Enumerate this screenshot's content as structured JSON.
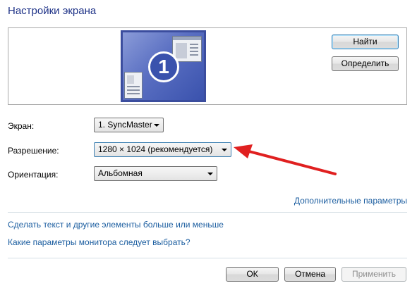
{
  "window": {
    "title": "Настройки экрана"
  },
  "monitor_preview": {
    "monitor_number": "1",
    "identify_buttons": {
      "find": "Найти",
      "detect": "Определить"
    }
  },
  "settings": {
    "display": {
      "label": "Экран:",
      "value": "1. SyncMaster"
    },
    "resolution": {
      "label": "Разрешение:",
      "value": "1280 × 1024 (рекомендуется)"
    },
    "orientation": {
      "label": "Ориентация:",
      "value": "Альбомная"
    }
  },
  "links": {
    "advanced": "Дополнительные параметры",
    "text_size": "Сделать текст и другие элементы больше или меньше",
    "which_settings": "Какие параметры монитора следует выбрать?"
  },
  "footer": {
    "ok": "ОК",
    "cancel": "Отмена",
    "apply": "Применить"
  },
  "colors": {
    "title": "#1e3287",
    "link": "#1c5ea0",
    "annotation_arrow": "#e02020"
  }
}
